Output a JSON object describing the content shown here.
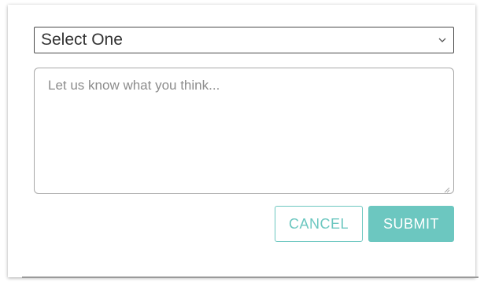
{
  "form": {
    "select": {
      "selected": "Select One"
    },
    "comment": {
      "placeholder": "Let us know what you think..."
    },
    "buttons": {
      "cancel_label": "CANCEL",
      "submit_label": "SUBMIT"
    }
  },
  "colors": {
    "accent": "#6cc7c0",
    "border": "#4a4a4a",
    "text": "#333333"
  },
  "icons": {
    "select": "chevron-down-icon",
    "textarea": "resize-grip-icon"
  }
}
